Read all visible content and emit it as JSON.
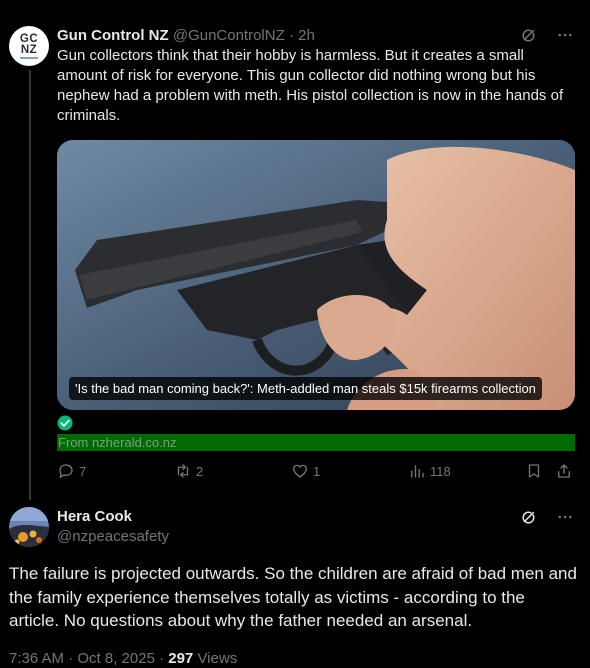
{
  "tweet1": {
    "avatar_text_top": "GC",
    "avatar_text_bottom": "NZ",
    "display_name": "Gun Control NZ",
    "handle": "@GunControlNZ",
    "separator": "·",
    "time": "2h",
    "body": "Gun collectors think that their hobby is harmless. But it creates a small amount of risk for everyone. This gun collector did nothing wrong but his nephew had a problem with meth. His pistol collection is now in the hands of criminals.",
    "card": {
      "title": "'Is the bad man coming back?': Meth-addled man steals $15k firearms collection",
      "source": "From nzherald.co.nz"
    },
    "actions": {
      "replies": "7",
      "reposts": "2",
      "likes": "1",
      "views": "118"
    }
  },
  "tweet2": {
    "display_name": "Hera Cook",
    "handle": "@nzpeacesafety",
    "body": "The failure is projected outwards. So the children are afraid of bad men and the family experience themselves totally as victims - according to the article. No questions about why the father needed an arsenal.",
    "timestamp": "7:36 AM · Oct 8, 2025 · ",
    "views_count": "297",
    "views_label": " Views"
  },
  "icons": {
    "grok": "grok-icon",
    "more": "more-icon",
    "reply": "reply-icon",
    "repost": "repost-icon",
    "like": "heart-icon",
    "views": "views-icon",
    "bookmark": "bookmark-icon",
    "share": "share-icon",
    "verified_check": "check-circle-icon"
  },
  "colors": {
    "background": "#000000",
    "text": "#e7e9ea",
    "muted": "#71767b",
    "source_bar": "#006b00",
    "check_green": "#00ba7c"
  }
}
